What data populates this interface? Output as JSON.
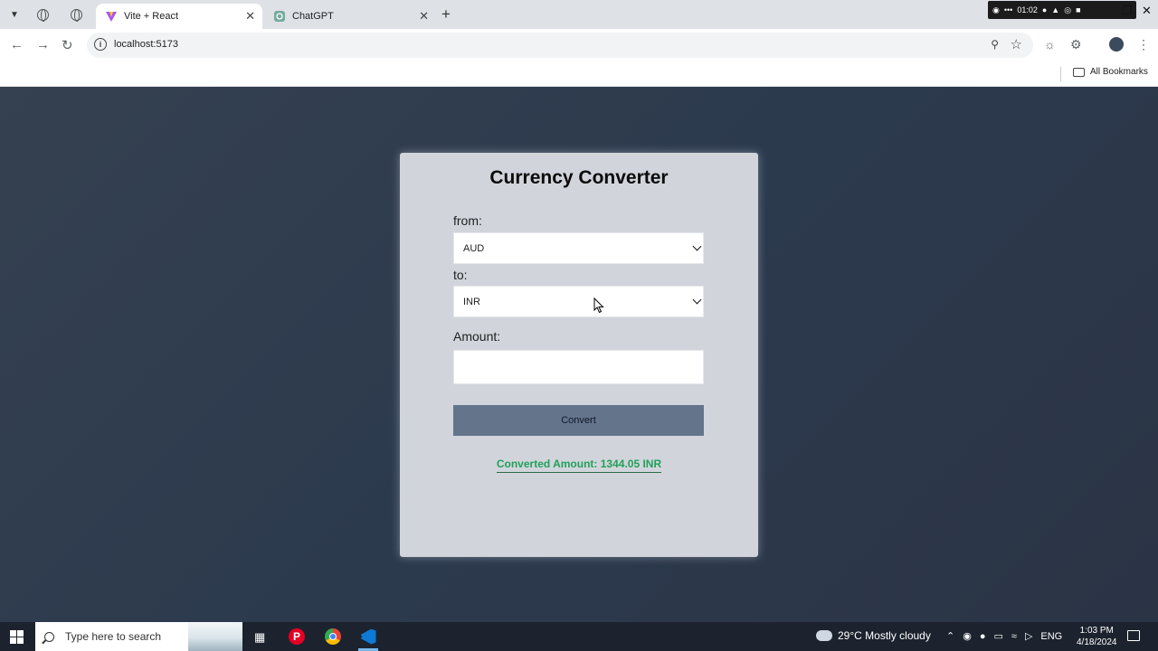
{
  "browser": {
    "tabs": [
      {
        "title": "Vite + React",
        "active": true
      },
      {
        "title": "ChatGPT",
        "active": false
      }
    ],
    "url": "localhost:5173",
    "bookmarks_label": "All Bookmarks",
    "tray_time": "01:02"
  },
  "app": {
    "title": "Currency Converter",
    "from_label": "from:",
    "from_value": "AUD",
    "to_label": "to:",
    "to_value": "INR",
    "amount_label": "Amount:",
    "amount_value": "",
    "convert_label": "Convert",
    "result_text": "Converted Amount: 1344.05 INR"
  },
  "taskbar": {
    "search_placeholder": "Type here to search",
    "weather": "29°C  Mostly cloudy",
    "language": "ENG",
    "time": "1:03 PM",
    "date": "4/18/2024"
  },
  "colors": {
    "page_bg": "#2f3b4c",
    "card_bg": "#d1d5db",
    "button_bg": "#64748b",
    "result_text": "#22a05a"
  }
}
